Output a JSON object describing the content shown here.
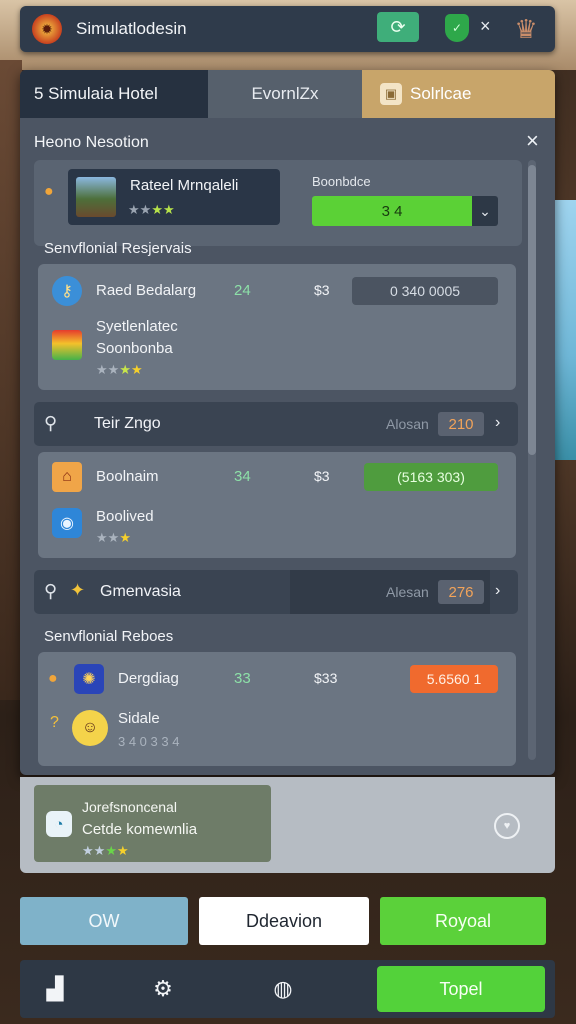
{
  "topbar": {
    "title": "Simulatlodesin",
    "logo_icon": "emblem-icon",
    "refresh_icon": "refresh-icon",
    "shield_icon": "shield-icon",
    "close_glyph": "×",
    "crest_icon": "crest-icon"
  },
  "tabs": [
    {
      "label": "5 Simulaia Hotel"
    },
    {
      "label": "EvornlZx"
    },
    {
      "label": "Solrlcae"
    }
  ],
  "panel": {
    "section_title": "Heono Nesotion",
    "close_glyph": "×"
  },
  "hotel": {
    "name": "Rateel Mrnqaleli",
    "stars_gray": "★★",
    "stars_green": "★★",
    "select_label": "Boonbdce",
    "select_value": "3 4"
  },
  "section1": {
    "title": "Senvflonial Resjervais",
    "items": [
      {
        "name": "Raed Bedalarg",
        "num": "24",
        "price": "$3",
        "btn": "0  340 0005"
      },
      {
        "name_line1": "Syetlenlatec",
        "name_line2": "Soonbonba",
        "stars_gray": "★★",
        "stars_green": "★",
        "stars_yellow": "★"
      }
    ]
  },
  "search1": {
    "name": "Teir Zngo",
    "muted": "Alosan",
    "badge": "210"
  },
  "section2": {
    "items": [
      {
        "name": "Boolnaim",
        "num": "34",
        "price": "$3",
        "btn": "(5163 303)"
      },
      {
        "name": "Boolived",
        "stars_gray": "★★",
        "stars_yellow": "★"
      }
    ]
  },
  "search2": {
    "name": "Gmenvasia",
    "muted": "Alesan",
    "badge": "276"
  },
  "section3": {
    "title": "Senvflonial Reboes",
    "items": [
      {
        "name": "Dergdiag",
        "num": "33",
        "price": "$33",
        "btn": "5.6560 1"
      },
      {
        "name": "Sidale",
        "sub": "3 4 0   3 3 4"
      }
    ]
  },
  "bottom_card": {
    "title": "Jorefsnoncenal",
    "subtitle": "Cetde komewnlia",
    "stars_gray": "★★",
    "stars_green": "★",
    "stars_yellow": "★"
  },
  "actions": {
    "left": "OW",
    "middle": "Ddeavion",
    "right": "Royoal"
  },
  "navbar": {
    "home_icon": "building-icon",
    "settings_icon": "gear-icon",
    "badge_icon": "badge-icon",
    "go_label": "Topel"
  },
  "colors": {
    "accent_green": "#53d23a",
    "accent_orange": "#f06a2e",
    "panel_bg": "#4c5563",
    "tab_gold": "#c8a56a"
  }
}
